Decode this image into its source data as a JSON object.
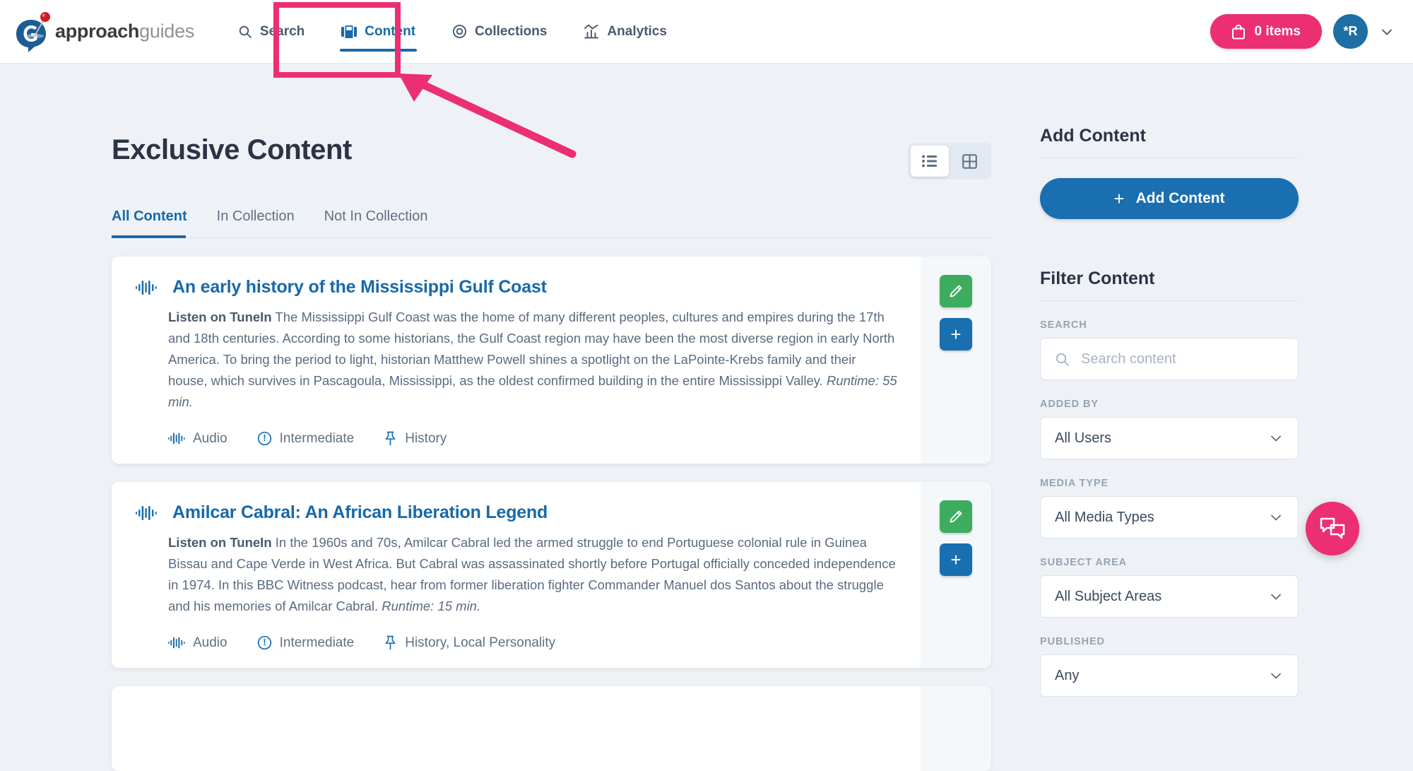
{
  "header": {
    "logo": {
      "brand_bold": "approach",
      "brand_light": "guides",
      "icon": "approachguides-logo-icon"
    },
    "nav": [
      {
        "label": "Search",
        "icon": "search-icon",
        "active": false
      },
      {
        "label": "Content",
        "icon": "content-images-icon",
        "active": true
      },
      {
        "label": "Collections",
        "icon": "target-circle-icon",
        "active": false
      },
      {
        "label": "Analytics",
        "icon": "bar-chart-icon",
        "active": false
      }
    ],
    "cart": {
      "label": "0 items",
      "icon": "shopping-bag-icon"
    },
    "avatar": {
      "initials": "*R"
    },
    "account_caret": "chevron-down-icon"
  },
  "main": {
    "page_title": "Exclusive Content",
    "view_toggle": [
      {
        "name": "list-view",
        "icon": "list-icon",
        "active": true
      },
      {
        "name": "grid-view",
        "icon": "grid-icon",
        "active": false
      }
    ],
    "tabs": [
      {
        "label": "All Content",
        "active": true
      },
      {
        "label": "In Collection",
        "active": false
      },
      {
        "label": "Not In Collection",
        "active": false
      }
    ],
    "cards": [
      {
        "title": "An early history of the Mississippi Gulf Coast",
        "source": "Listen on TuneIn",
        "description": " The Mississippi Gulf Coast was the home of many different peoples, cultures and empires during the 17th and 18th centuries. According to some historians, the Gulf Coast region may have been the most diverse region in early North America. To bring the period to light, historian Matthew Powell shines a spotlight on the LaPointe-Krebs family and their house, which survives in Pascagoula, Mississippi, as the oldest confirmed building in the entire Mississippi Valley. ",
        "runtime": "Runtime: 55 min.",
        "meta": {
          "media_type": "Audio",
          "level": "Intermediate",
          "subjects": "History"
        },
        "actions": {
          "edit": "edit-pencil",
          "add": "+"
        }
      },
      {
        "title": "Amilcar Cabral: An African Liberation Legend",
        "source": "Listen on TuneIn",
        "description": " In the 1960s and 70s, Amilcar Cabral led the armed struggle to end Portuguese colonial rule in Guinea Bissau and Cape Verde in West Africa. But Cabral was assassinated shortly before Portugal officially conceded independence in 1974. In this BBC Witness podcast, hear from former liberation fighter Commander Manuel dos Santos about the struggle and his memories of Amilcar Cabral. ",
        "runtime": "Runtime: 15 min.",
        "meta": {
          "media_type": "Audio",
          "level": "Intermediate",
          "subjects": "History, Local Personality"
        },
        "actions": {
          "edit": "edit-pencil",
          "add": "+"
        }
      }
    ]
  },
  "sidebar": {
    "add_heading": "Add Content",
    "add_button": "Add Content",
    "filter_heading": "Filter Content",
    "filters": [
      {
        "label": "SEARCH",
        "type": "search",
        "value": "",
        "placeholder": "Search content"
      },
      {
        "label": "ADDED BY",
        "type": "select",
        "value": "All Users"
      },
      {
        "label": "MEDIA TYPE",
        "type": "select",
        "value": "All Media Types"
      },
      {
        "label": "SUBJECT AREA",
        "type": "select",
        "value": "All Subject Areas"
      },
      {
        "label": "PUBLISHED",
        "type": "select",
        "value": "Any"
      }
    ]
  },
  "chat": {
    "icon": "chat-bubbles-icon"
  },
  "annotation": {
    "highlight_target": "Content",
    "color": "#ec2e72"
  },
  "colors": {
    "accent_pink": "#ec2e72",
    "primary_blue": "#1a6fb0",
    "link_blue": "#1769aa",
    "green": "#3eac5f",
    "page_bg": "#eef2f6"
  }
}
